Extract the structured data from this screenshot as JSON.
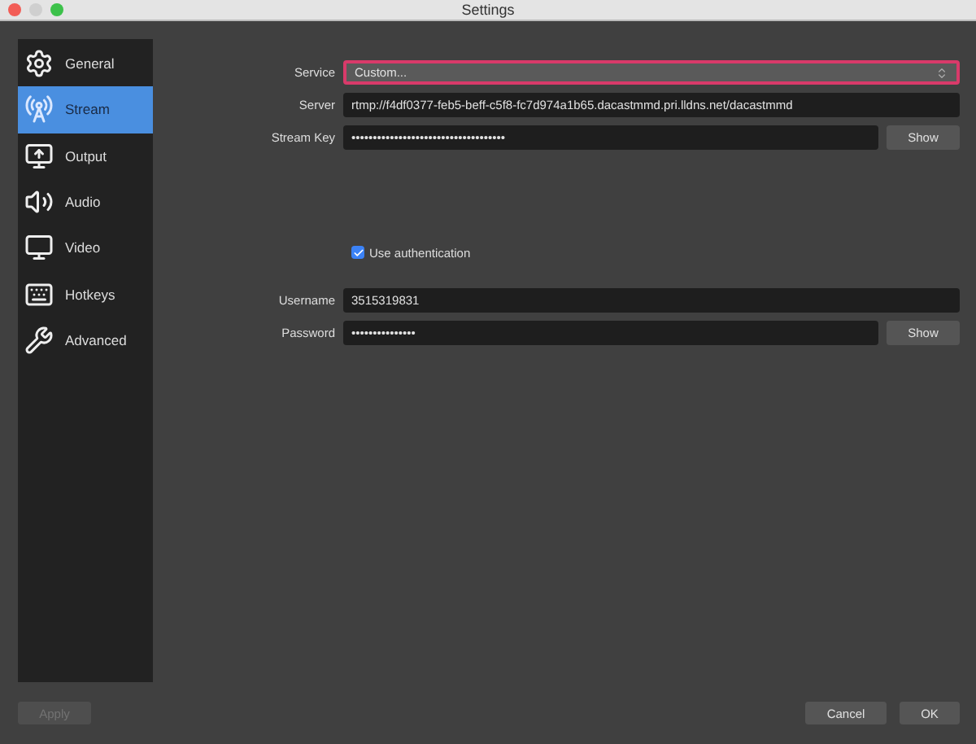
{
  "window": {
    "title": "Settings"
  },
  "sidebar": {
    "items": [
      {
        "label": "General",
        "selected": false
      },
      {
        "label": "Stream",
        "selected": true
      },
      {
        "label": "Output",
        "selected": false
      },
      {
        "label": "Audio",
        "selected": false
      },
      {
        "label": "Video",
        "selected": false
      },
      {
        "label": "Hotkeys",
        "selected": false
      },
      {
        "label": "Advanced",
        "selected": false
      }
    ]
  },
  "form": {
    "service": {
      "label": "Service",
      "value": "Custom...",
      "focused": true
    },
    "server": {
      "label": "Server",
      "value": "rtmp://f4df0377-feb5-beff-c5f8-fc7d974a1b65.dacastmmd.pri.lldns.net/dacastmmd"
    },
    "stream_key": {
      "label": "Stream Key",
      "value": "••••••••••••••••••••••••••••••••••••",
      "button": "Show"
    },
    "use_authentication": {
      "label": "Use authentication",
      "checked": true
    },
    "username": {
      "label": "Username",
      "value": "3515319831"
    },
    "password": {
      "label": "Password",
      "value": "•••••••••••••••",
      "button": "Show"
    }
  },
  "buttons": [
    {
      "label": "Apply",
      "disabled": true
    },
    {
      "label": "Cancel",
      "disabled": false
    },
    {
      "label": "OK",
      "disabled": false
    }
  ]
}
